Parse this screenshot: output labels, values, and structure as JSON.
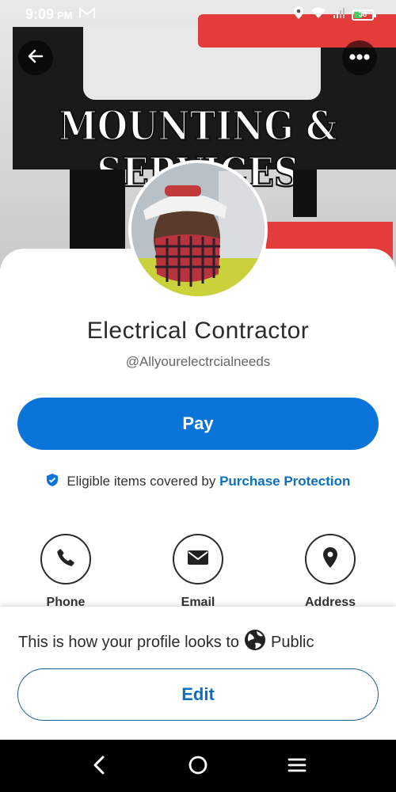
{
  "status_bar": {
    "time": "9:09",
    "ampm": "PM",
    "battery": "38",
    "icons": [
      "gmail-icon",
      "location-icon",
      "wifi-icon",
      "signal-icon",
      "battery-icon"
    ]
  },
  "header": {
    "back_icon": "arrow-left-icon",
    "more_icon": "more-horizontal-icon"
  },
  "cover": {
    "banner_text": "MOUNTING & SERVICES"
  },
  "profile": {
    "name": "Electrical Contractor",
    "handle": "@Allyourelectrcialneeds"
  },
  "actions": {
    "pay_label": "Pay",
    "protection_text": "Eligible items covered by",
    "protection_link": "Purchase Protection"
  },
  "contacts": [
    {
      "label": "Phone",
      "icon": "phone-icon"
    },
    {
      "label": "Email",
      "icon": "mail-icon"
    },
    {
      "label": "Address",
      "icon": "map-pin-icon"
    }
  ],
  "sheet": {
    "message": "This is how your profile looks to",
    "audience": "Public",
    "edit_label": "Edit"
  },
  "colors": {
    "primary": "#0a74d8",
    "link": "#0a6fc2",
    "nav": "#000000"
  }
}
